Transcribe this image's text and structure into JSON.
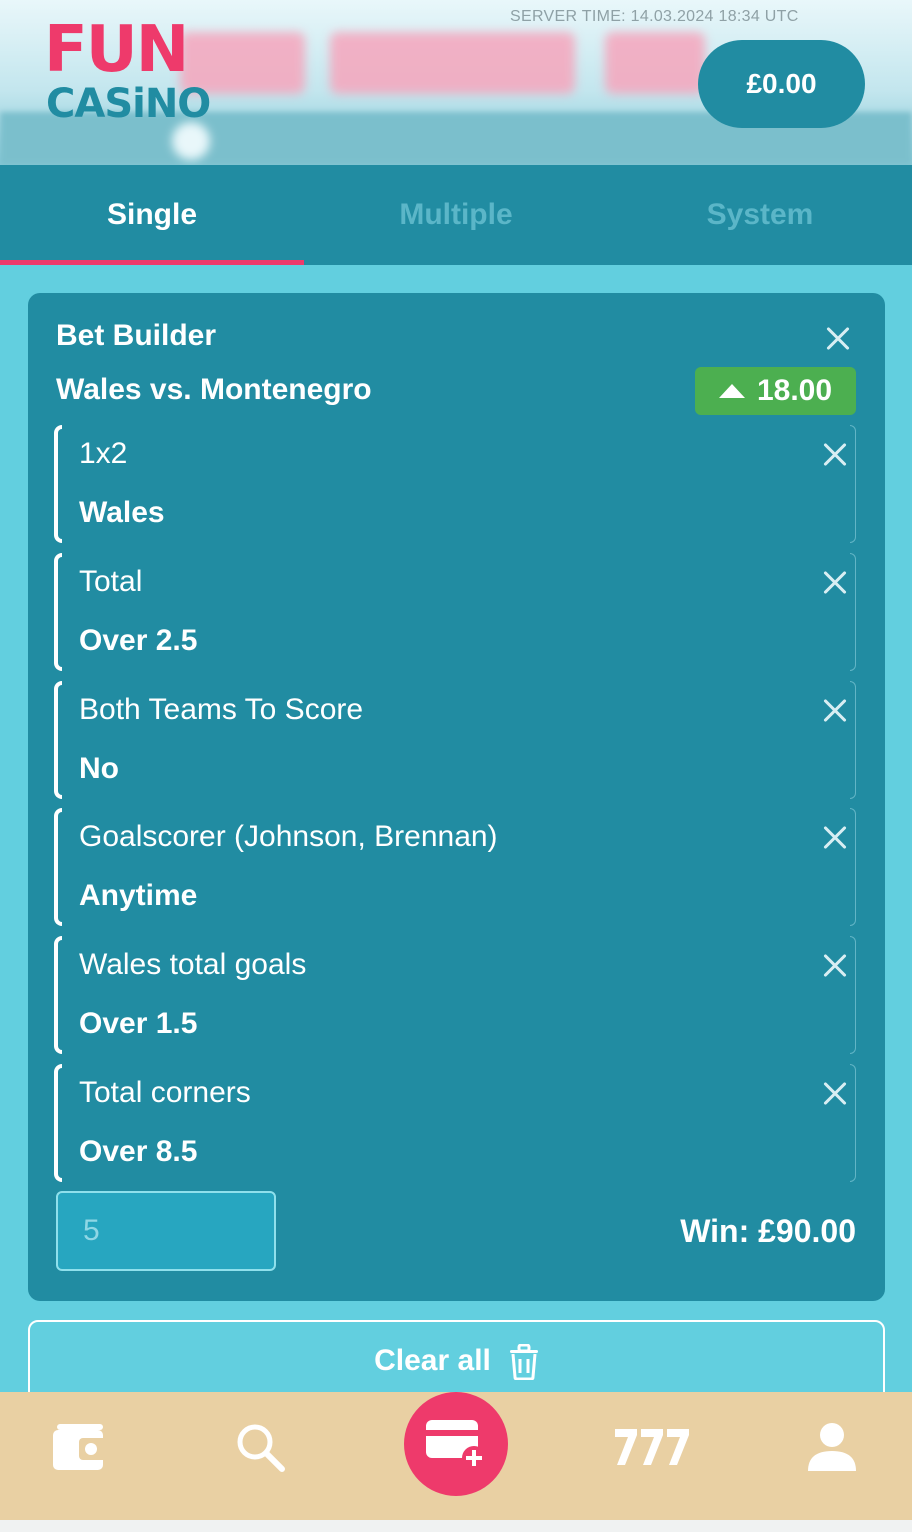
{
  "header": {
    "logo_top": "FUN",
    "logo_bottom": "CASiNO",
    "server_time": "SERVER TIME: 14.03.2024 18:34 UTC",
    "balance": "£0.00"
  },
  "tabs": [
    {
      "label": "Single",
      "active": true
    },
    {
      "label": "Multiple",
      "active": false
    },
    {
      "label": "System",
      "active": false
    }
  ],
  "betslip": {
    "title": "Bet Builder",
    "match": "Wales vs. Montenegro",
    "odds": "18.00",
    "selections": [
      {
        "market": "1x2",
        "pick": "Wales"
      },
      {
        "market": "Total",
        "pick": "Over 2.5"
      },
      {
        "market": "Both Teams To Score",
        "pick": "No"
      },
      {
        "market": "Goalscorer (Johnson, Brennan)",
        "pick": "Anytime"
      },
      {
        "market": "Wales total goals",
        "pick": "Over 1.5"
      },
      {
        "market": "Total corners",
        "pick": "Over 8.5"
      }
    ],
    "stake": "5",
    "win": "Win: £90.00"
  },
  "clear_all": "Clear all",
  "bottom_nav": [
    {
      "icon": "wallet-icon"
    },
    {
      "icon": "search-icon"
    },
    {
      "icon": "betslip-add-icon"
    },
    {
      "icon": "slots-777-icon"
    },
    {
      "icon": "user-icon"
    }
  ],
  "colors": {
    "accent_pink": "#ee3a6b",
    "teal": "#218ca2",
    "light_teal": "#62cfdf",
    "green": "#4caf50",
    "nav_bg": "#e9d0a3"
  }
}
